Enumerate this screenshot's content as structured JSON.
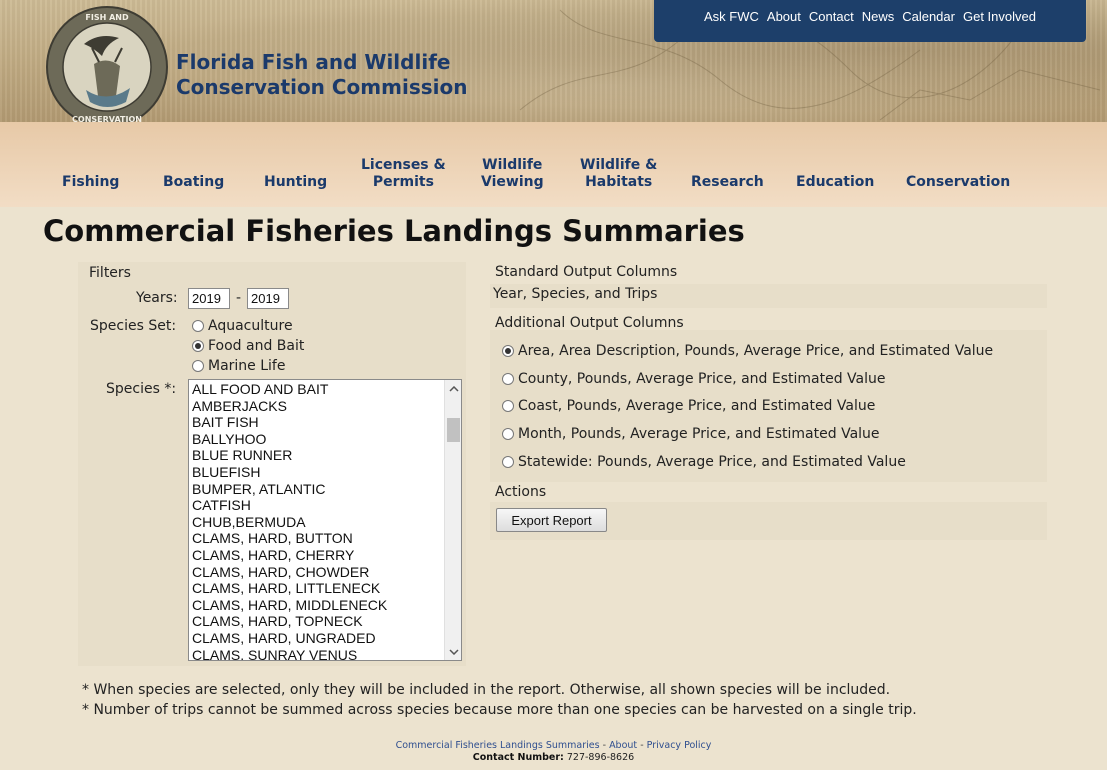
{
  "header": {
    "title_line1": "Florida Fish and Wildlife",
    "title_line2": "Conservation Commission",
    "logo_text": "FLORIDA FISH AND WILDLIFE CONSERVATION COMMISSION"
  },
  "util_links": [
    "Ask FWC",
    "About",
    "Contact",
    "News",
    "Calendar",
    "Get Involved"
  ],
  "nav": [
    {
      "line1": "",
      "line2": "Fishing"
    },
    {
      "line1": "",
      "line2": "Boating"
    },
    {
      "line1": "",
      "line2": "Hunting"
    },
    {
      "line1": "Licenses &",
      "line2": "Permits"
    },
    {
      "line1": "Wildlife",
      "line2": "Viewing"
    },
    {
      "line1": "Wildlife &",
      "line2": "Habitats"
    },
    {
      "line1": "",
      "line2": "Research"
    },
    {
      "line1": "",
      "line2": "Education"
    },
    {
      "line1": "",
      "line2": "Conservation"
    }
  ],
  "page": {
    "title": "Commercial Fisheries Landings Summaries"
  },
  "filters": {
    "heading": "Filters",
    "years_label": "Years:",
    "year_from": "2019",
    "year_sep": "-",
    "year_to": "2019",
    "species_set_label": "Species Set:",
    "species_set_options": [
      {
        "label": "Aquaculture",
        "selected": false
      },
      {
        "label": "Food and Bait",
        "selected": true
      },
      {
        "label": "Marine Life",
        "selected": false
      }
    ],
    "species_label": "Species *:",
    "species_options": [
      "ALL FOOD AND BAIT",
      "AMBERJACKS",
      "BAIT FISH",
      "BALLYHOO",
      "BLUE RUNNER",
      "BLUEFISH",
      "BUMPER, ATLANTIC",
      "CATFISH",
      "CHUB,BERMUDA",
      "CLAMS, HARD, BUTTON",
      "CLAMS, HARD, CHERRY",
      "CLAMS, HARD, CHOWDER",
      "CLAMS, HARD, LITTLENECK",
      "CLAMS, HARD, MIDDLENECK",
      "CLAMS, HARD, TOPNECK",
      "CLAMS, HARD, UNGRADED",
      "CLAMS, SUNRAY VENUS"
    ]
  },
  "output": {
    "standard_heading": "Standard Output Columns",
    "standard_value": "Year, Species, and Trips",
    "additional_heading": "Additional Output Columns",
    "additional_options": [
      {
        "label": "Area, Area Description, Pounds, Average Price, and Estimated Value",
        "selected": true
      },
      {
        "label": "County, Pounds, Average Price, and Estimated Value",
        "selected": false
      },
      {
        "label": "Coast, Pounds, Average Price, and Estimated Value",
        "selected": false
      },
      {
        "label": "Month, Pounds, Average Price, and Estimated Value",
        "selected": false
      },
      {
        "label": "Statewide: Pounds, Average Price, and Estimated Value",
        "selected": false
      }
    ],
    "actions_heading": "Actions",
    "export_label": "Export Report"
  },
  "notes": [
    "* When species are selected, only they will be included in the report. Otherwise, all shown species will be included.",
    "* Number of trips cannot be summed across species because more than one species can be harvested on a single trip."
  ],
  "footer": {
    "link1": "Commercial Fisheries Landings Summaries",
    "sep": "-",
    "link2": "About",
    "link3": "Privacy Policy",
    "contact_label": "Contact Number:",
    "contact_value": "727-896-8626"
  },
  "colors": {
    "brand_navy": "#1b3a6b",
    "util_bar": "#1d3f6a",
    "page_bg": "#ece3cf",
    "panel_bg": "#e7dec9"
  }
}
